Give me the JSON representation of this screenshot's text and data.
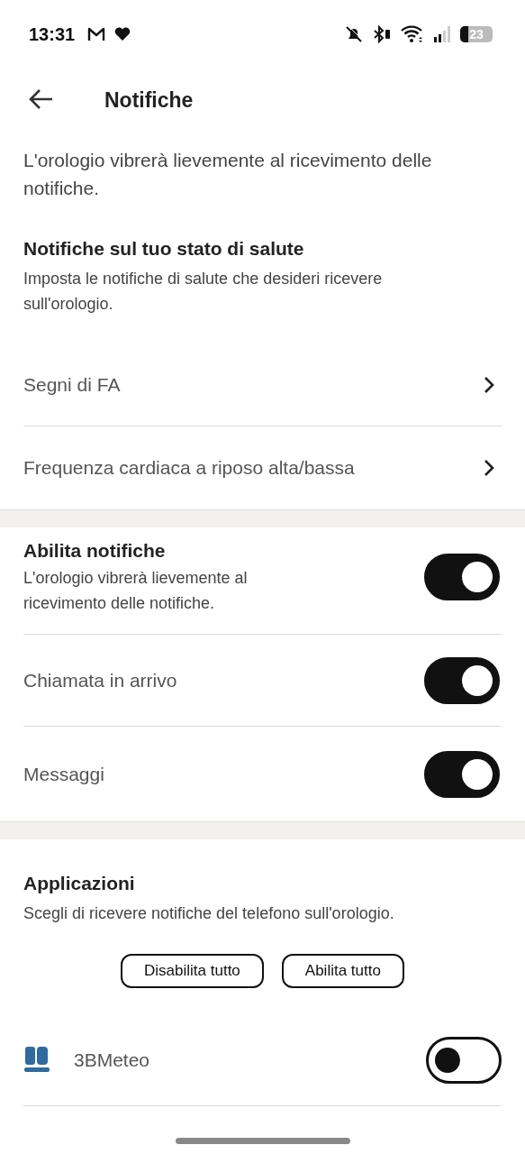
{
  "status_bar": {
    "time": "13:31",
    "battery": "23"
  },
  "header": {
    "title": "Notifiche"
  },
  "intro": "L'orologio vibrerà lievemente al ricevimento delle notifiche.",
  "health": {
    "title": "Notifiche sul tuo stato di salute",
    "subtitle": "Imposta le notifiche di salute che desideri ricevere sull'orologio.",
    "items": [
      {
        "label": "Segni di FA"
      },
      {
        "label": "Frequenza cardiaca a riposo alta/bassa"
      }
    ]
  },
  "notifications": [
    {
      "label": "Abilita notifiche",
      "subtitle": "L'orologio vibrerà lievemente al ricevimento delle notifiche.",
      "on": true
    },
    {
      "label": "Chiamata in arrivo",
      "on": true
    },
    {
      "label": "Messaggi",
      "on": true
    }
  ],
  "apps": {
    "title": "Applicazioni",
    "subtitle": "Scegli di ricevere notifiche del telefono sull'orologio.",
    "buttons": [
      "Disabilita tutto",
      "Abilita tutto"
    ],
    "items": [
      {
        "name": "3BMeteo",
        "on": false
      }
    ]
  }
}
